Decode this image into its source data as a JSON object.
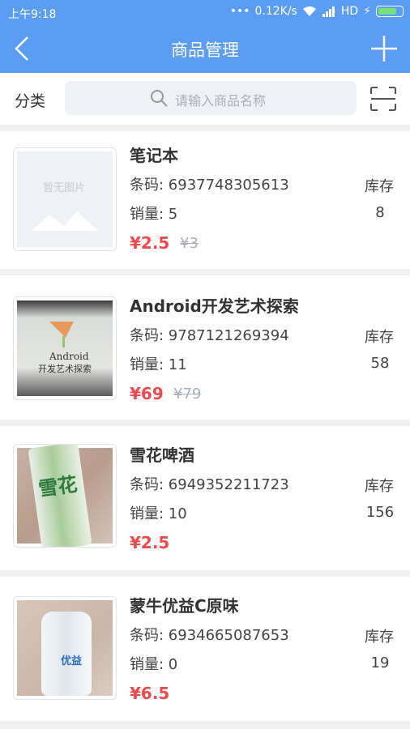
{
  "status_bar": {
    "time": "上午9:18",
    "network": "0.12K/s",
    "signal_label": "HD",
    "battery_level": 0.8
  },
  "header": {
    "title": "商品管理"
  },
  "search": {
    "category_label": "分类",
    "placeholder": "请输入商品名称"
  },
  "products": [
    {
      "name": "笔记本",
      "barcode": "条码: 6937748305613",
      "sales": "销量: 5",
      "price": "¥2.5",
      "old_price": "¥3",
      "stock_label": "库存",
      "stock": "8",
      "image_placeholder": "暂无图片"
    },
    {
      "name": "Android开发艺术探索",
      "barcode": "条码: 9787121269394",
      "sales": "销量: 11",
      "price": "¥69",
      "old_price": "¥79",
      "stock_label": "库存",
      "stock": "58",
      "image_text_1": "Android",
      "image_text_2": "开发艺术探索"
    },
    {
      "name": "雪花啤酒",
      "barcode": "条码: 6949352211723",
      "sales": "销量: 10",
      "price": "¥2.5",
      "stock_label": "库存",
      "stock": "156",
      "image_text_1": "雪花"
    },
    {
      "name": "蒙牛优益C原味",
      "barcode": "条码: 6934665087653",
      "sales": "销量: 0",
      "price": "¥6.5",
      "stock_label": "库存",
      "stock": "19",
      "image_text_1": "优益"
    }
  ],
  "colors": {
    "primary": "#5b9df5",
    "price": "#f0494b",
    "muted": "#aab0b8"
  }
}
